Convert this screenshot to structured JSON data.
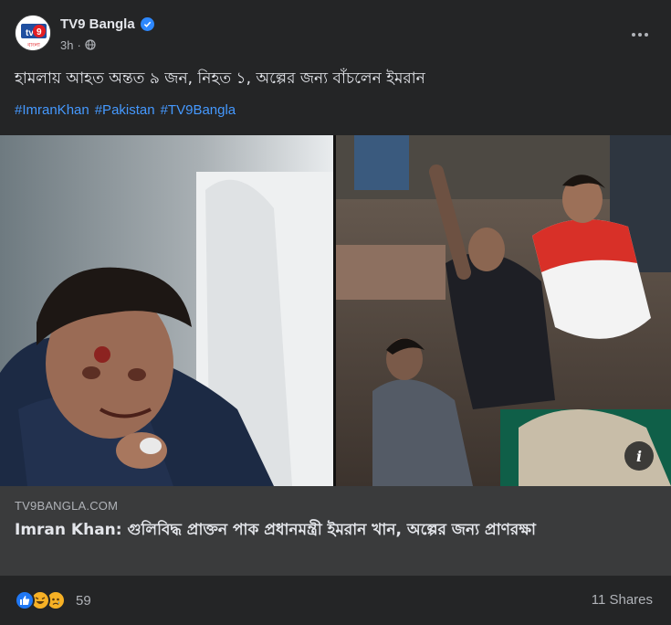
{
  "post": {
    "page_name": "TV9 Bangla",
    "timestamp": "3h",
    "privacy_icon": "globe-icon",
    "text": "হামলায় আহত অন্তত ৯ জন, নিহত ১, অল্পের জন্য বাঁচলেন ইমরান",
    "hashtags": [
      "#ImranKhan",
      "#Pakistan",
      "#TV9Bangla"
    ]
  },
  "avatar": {
    "logo_text": "tv9",
    "sub_text": "বাংলা"
  },
  "link": {
    "domain": "TV9BANGLA.COM",
    "title": "Imran Khan: গুলিবিদ্ধ প্রাক্তন পাক প্রধানমন্ত্রী ইমরান খান, অল্পের জন্য প্রাণরক্ষা"
  },
  "engagement": {
    "reaction_count": "59",
    "shares": "11 Shares",
    "reaction_types": [
      "like",
      "haha",
      "sad"
    ]
  },
  "colors": {
    "card_bg": "#242526",
    "link_footer_bg": "#3a3b3c",
    "hashtag": "#4599ff",
    "verified": "#2d88ff",
    "like": "#2078f4",
    "tv9_red": "#e31e24"
  }
}
